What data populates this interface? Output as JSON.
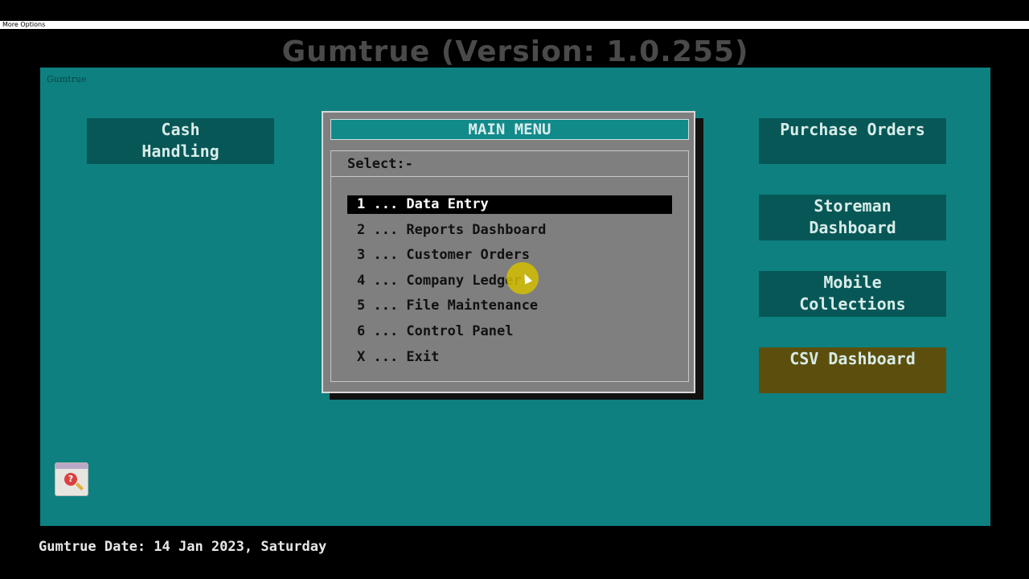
{
  "top_bar": {
    "label": "More Options"
  },
  "app_title": "Gumtrue (Version: 1.0.255)",
  "desktop": {
    "label": "Gumtrue"
  },
  "tiles": {
    "cash_handling": "Cash\nHandling",
    "purchase_orders": "Purchase Orders",
    "storeman_dashboard": "Storeman\nDashboard",
    "mobile_collections": "Mobile\nCollections",
    "csv_dashboard": "CSV Dashboard"
  },
  "help_icon": {
    "glyph": "?",
    "name": "help-search-icon"
  },
  "main_menu": {
    "title": "MAIN MENU",
    "select_label": "Select:-",
    "items": [
      {
        "text": "1 ... Data Entry",
        "selected": true
      },
      {
        "text": "2 ... Reports Dashboard",
        "selected": false
      },
      {
        "text": "3 ... Customer Orders",
        "selected": false
      },
      {
        "text": "4 ... Company Ledger",
        "selected": false
      },
      {
        "text": "5 ... File Maintenance",
        "selected": false
      },
      {
        "text": "6 ... Control Panel",
        "selected": false
      },
      {
        "text": "X ... Exit",
        "selected": false
      }
    ]
  },
  "status_bar": {
    "text": "Gumtrue Date: 14 Jan 2023, Saturday"
  },
  "colors": {
    "desktop": "#0e8080",
    "tile": "#075757",
    "csv_tile": "#5c4f0d",
    "menu_window": "#7f7f7f",
    "menu_title": "#128a8a",
    "selection": "#000000"
  }
}
